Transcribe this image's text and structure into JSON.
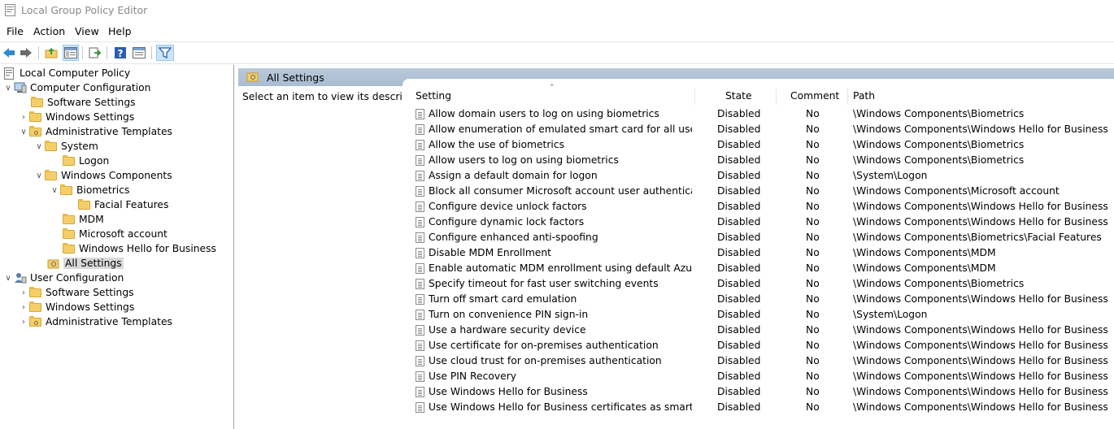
{
  "window": {
    "title": "Local Group Policy Editor"
  },
  "menu": [
    "File",
    "Action",
    "View",
    "Help"
  ],
  "toolbar": {
    "icons": [
      "back-arrow-icon",
      "forward-arrow-icon",
      "up-folder-icon",
      "show-hide-tree-icon",
      "export-list-icon",
      "help-icon",
      "properties-icon",
      "filter-icon"
    ]
  },
  "tree": [
    {
      "label": "Local Computer Policy"
    },
    {
      "label": "Computer Configuration"
    },
    {
      "label": "Software Settings"
    },
    {
      "label": "Windows Settings"
    },
    {
      "label": "Administrative Templates"
    },
    {
      "label": "System"
    },
    {
      "label": "Logon"
    },
    {
      "label": "Windows Components"
    },
    {
      "label": "Biometrics"
    },
    {
      "label": "Facial Features"
    },
    {
      "label": "MDM"
    },
    {
      "label": "Microsoft account"
    },
    {
      "label": "Windows Hello for Business"
    },
    {
      "label": "All Settings"
    },
    {
      "label": "User Configuration"
    },
    {
      "label": "Software Settings"
    },
    {
      "label": "Windows Settings"
    },
    {
      "label": "Administrative Templates"
    }
  ],
  "right": {
    "header": "All Settings",
    "description": "Select an item to view its description."
  },
  "columns": {
    "setting": "Setting",
    "state": "State",
    "comment": "Comment",
    "path": "Path"
  },
  "rows": [
    {
      "setting": "Allow domain users to log on using biometrics",
      "state": "Disabled",
      "comment": "No",
      "path": "\\Windows Components\\Biometrics"
    },
    {
      "setting": "Allow enumeration of emulated smart card for all users",
      "state": "Disabled",
      "comment": "No",
      "path": "\\Windows Components\\Windows Hello for Business"
    },
    {
      "setting": "Allow the use of biometrics",
      "state": "Disabled",
      "comment": "No",
      "path": "\\Windows Components\\Biometrics"
    },
    {
      "setting": "Allow users to log on using biometrics",
      "state": "Disabled",
      "comment": "No",
      "path": "\\Windows Components\\Biometrics"
    },
    {
      "setting": "Assign a default domain for logon",
      "state": "Disabled",
      "comment": "No",
      "path": "\\System\\Logon"
    },
    {
      "setting": "Block all consumer Microsoft account user authentication",
      "state": "Disabled",
      "comment": "No",
      "path": "\\Windows Components\\Microsoft account"
    },
    {
      "setting": "Configure device unlock factors",
      "state": "Disabled",
      "comment": "No",
      "path": "\\Windows Components\\Windows Hello for Business"
    },
    {
      "setting": "Configure dynamic lock factors",
      "state": "Disabled",
      "comment": "No",
      "path": "\\Windows Components\\Windows Hello for Business"
    },
    {
      "setting": "Configure enhanced anti-spoofing",
      "state": "Disabled",
      "comment": "No",
      "path": "\\Windows Components\\Biometrics\\Facial Features"
    },
    {
      "setting": "Disable MDM Enrollment",
      "state": "Disabled",
      "comment": "No",
      "path": "\\Windows Components\\MDM"
    },
    {
      "setting": "Enable automatic MDM enrollment using default Azure AD ...",
      "state": "Disabled",
      "comment": "No",
      "path": "\\Windows Components\\MDM"
    },
    {
      "setting": "Specify timeout for fast user switching events",
      "state": "Disabled",
      "comment": "No",
      "path": "\\Windows Components\\Biometrics"
    },
    {
      "setting": "Turn off smart card emulation",
      "state": "Disabled",
      "comment": "No",
      "path": "\\Windows Components\\Windows Hello for Business"
    },
    {
      "setting": "Turn on convenience PIN sign-in",
      "state": "Disabled",
      "comment": "No",
      "path": "\\System\\Logon"
    },
    {
      "setting": "Use a hardware security device",
      "state": "Disabled",
      "comment": "No",
      "path": "\\Windows Components\\Windows Hello for Business"
    },
    {
      "setting": "Use certificate for on-premises authentication",
      "state": "Disabled",
      "comment": "No",
      "path": "\\Windows Components\\Windows Hello for Business"
    },
    {
      "setting": "Use cloud trust for on-premises authentication",
      "state": "Disabled",
      "comment": "No",
      "path": "\\Windows Components\\Windows Hello for Business"
    },
    {
      "setting": "Use PIN Recovery",
      "state": "Disabled",
      "comment": "No",
      "path": "\\Windows Components\\Windows Hello for Business"
    },
    {
      "setting": "Use Windows Hello for Business",
      "state": "Disabled",
      "comment": "No",
      "path": "\\Windows Components\\Windows Hello for Business"
    },
    {
      "setting": "Use Windows Hello for Business certificates as smart card ce...",
      "state": "Disabled",
      "comment": "No",
      "path": "\\Windows Components\\Windows Hello for Business"
    }
  ]
}
